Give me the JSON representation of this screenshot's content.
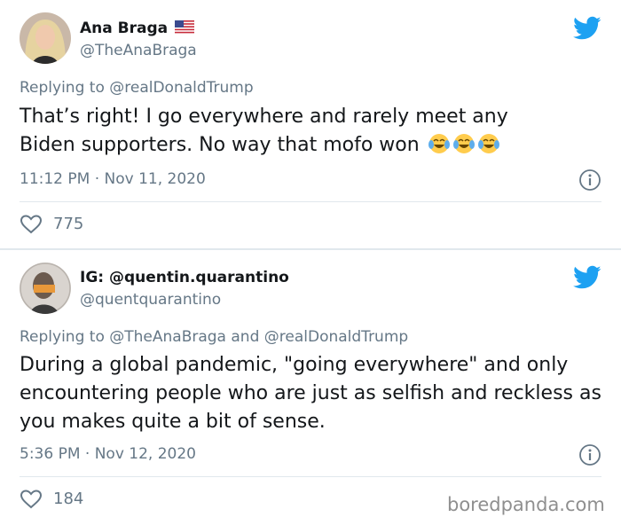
{
  "tweets": [
    {
      "author_name": "Ana Braga",
      "handle": "@TheAnaBraga",
      "replying_prefix": "Replying to",
      "replying_to": "@realDonaldTrump",
      "text_line1": "That’s right! I go everywhere and rarely meet any",
      "text_line2": "Biden supporters. No way that mofo won",
      "emoji": [
        "face-with-tears-of-joy",
        "face-with-tears-of-joy",
        "face-with-tears-of-joy"
      ],
      "timestamp": "11:12 PM · Nov 11, 2020",
      "likes": "775"
    },
    {
      "author_name": "IG: @quentin.quarantino",
      "handle": "@quentquarantino",
      "replying_prefix": "Replying to",
      "replying_to_1": "@TheAnaBraga",
      "replying_conj": "and",
      "replying_to_2": "@realDonaldTrump",
      "text": "During a global pandemic, \"going everywhere\" and only encountering people who are just as selfish and reckless as you makes quite a bit of sense.",
      "timestamp": "5:36 PM · Nov 12, 2020",
      "likes": "184"
    }
  ],
  "watermark": "boredpanda.com",
  "colors": {
    "twitter_blue": "#1da1f2",
    "secondary_text": "#657786",
    "divider": "#e1e8ed"
  },
  "icons": [
    "twitter-bird-icon",
    "info-icon",
    "heart-icon",
    "us-flag-icon"
  ]
}
